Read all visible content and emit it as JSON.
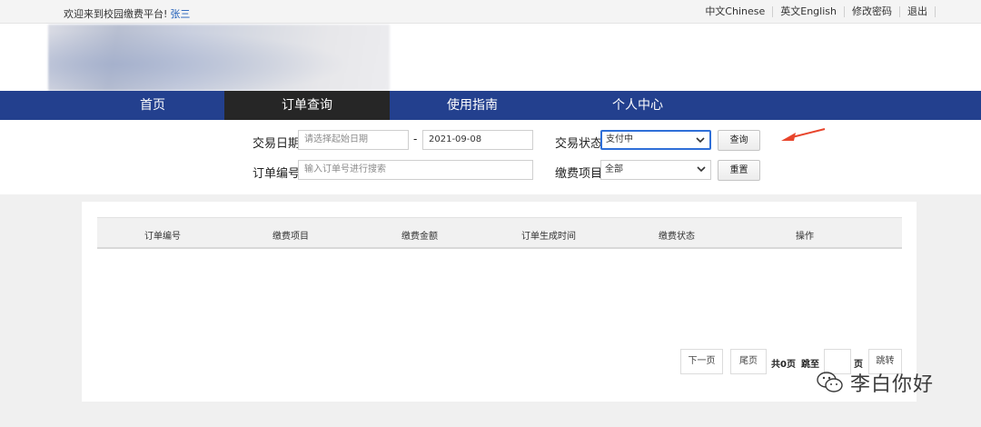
{
  "topbar": {
    "welcome": "欢迎来到校园缴费平台!",
    "user_name": "张三",
    "links": [
      "中文Chinese",
      "英文English",
      "修改密码",
      "退出"
    ]
  },
  "nav": {
    "items": [
      "首页",
      "订单查询",
      "使用指南",
      "个人中心"
    ],
    "active": "订单查询"
  },
  "search": {
    "date_label": "交易日期",
    "start_date_placeholder": "请选择起始日期",
    "date_separator": "-",
    "end_date_value": "2021-09-08",
    "status_label": "交易状态",
    "status_value": "支付中",
    "query_button": "查询",
    "order_label": "订单编号",
    "order_placeholder": "输入订单号进行搜索",
    "item_label": "缴费项目",
    "item_value": "全部",
    "reset_button": "重置"
  },
  "table": {
    "headers": [
      "订单编号",
      "缴费项目",
      "缴费金额",
      "订单生成时间",
      "缴费状态",
      "操作"
    ],
    "rows": []
  },
  "pagination": {
    "next": "下一页",
    "last": "尾页",
    "total": "共0页",
    "jump_to": "跳至",
    "page_unit": "页",
    "go": "跳转"
  },
  "watermark": {
    "text": "李白你好",
    "icon": "wechat-icon"
  },
  "colors": {
    "nav": "#23408e",
    "nav_active": "#262626",
    "arrow": "#e8452c",
    "link": "#1b5bb8"
  }
}
